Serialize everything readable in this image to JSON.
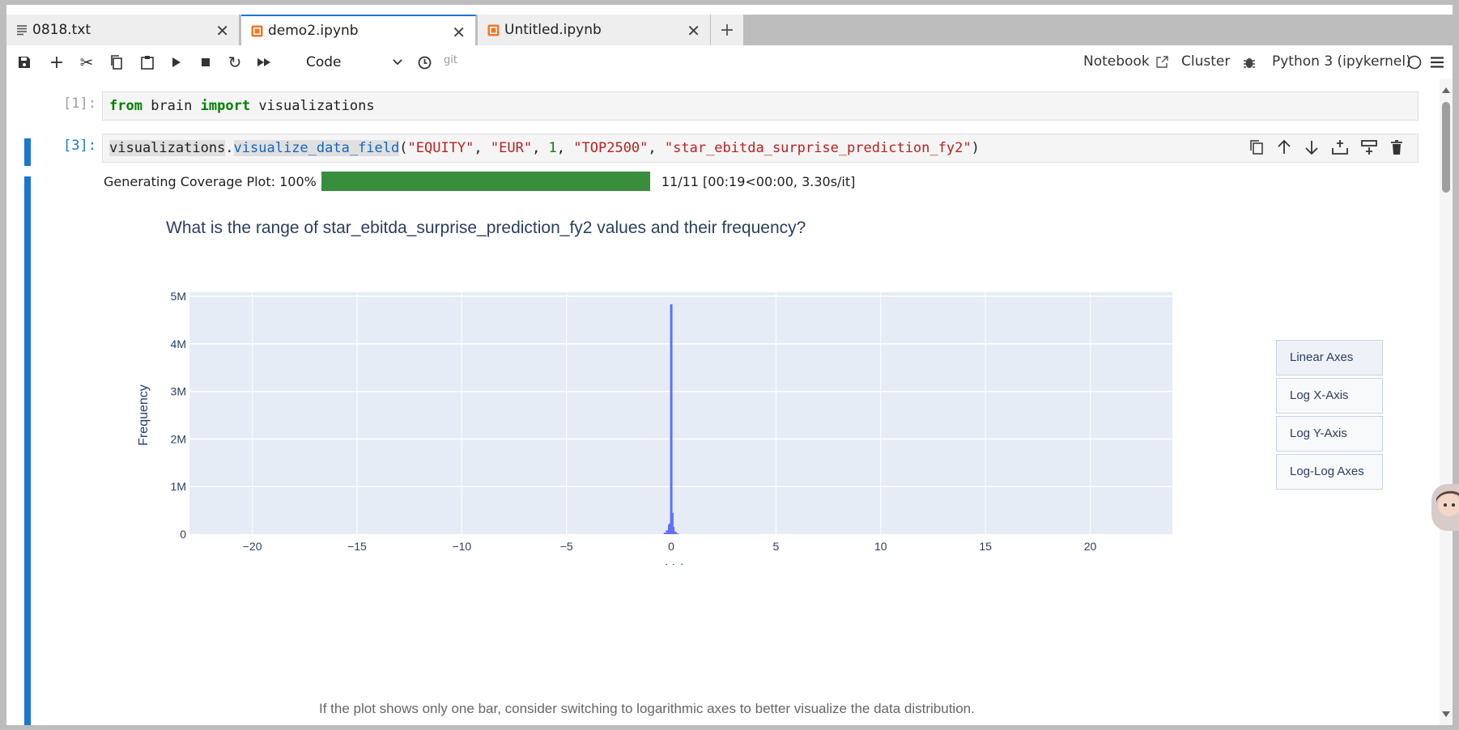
{
  "tabs": [
    {
      "label": "0818.txt",
      "icon": "text-file-icon",
      "active": false
    },
    {
      "label": "demo2.ipynb",
      "icon": "notebook-icon",
      "active": true
    },
    {
      "label": "Untitled.ipynb",
      "icon": "notebook-icon",
      "active": false
    }
  ],
  "toolbar": {
    "cell_type": "Code",
    "git_label": "git",
    "notebook_label": "Notebook",
    "cluster_label": "Cluster",
    "kernel_label": "Python 3 (ipykernel)"
  },
  "cells": [
    {
      "prompt": "[1]:",
      "code": {
        "kw1": "from",
        "mod": "brain",
        "kw2": "import",
        "name": "visualizations"
      }
    },
    {
      "prompt": "[3]:",
      "code": {
        "obj": "visualizations",
        "dot": ".",
        "fn": "visualize_data_field",
        "open": "(",
        "a1": "\"EQUITY\"",
        "c1": ", ",
        "a2": "\"EUR\"",
        "c2": ", ",
        "a3": "1",
        "c3": ", ",
        "a4": "\"TOP2500\"",
        "c4": ", ",
        "a5": "\"star_ebitda_surprise_prediction_fy2\"",
        "close": ")"
      }
    }
  ],
  "progress": {
    "label": "Generating  Coverage  Plot:  100%",
    "percent": 100,
    "stats": "11/11  [00:19<00:00,    3.30s/it]"
  },
  "plot": {
    "title": "What is the range of star_ebitda_surprise_prediction_fy2 values and their frequency?",
    "buttons": [
      "Linear Axes",
      "Log X-Axis",
      "Log Y-Axis",
      "Log-Log Axes"
    ],
    "active_button": "Linear Axes",
    "hint": "If the plot shows only one bar, consider switching to logarithmic axes to better visualize the data distribution."
  },
  "chart_data": {
    "type": "bar",
    "title": "What is the range of star_ebitda_surprise_prediction_fy2 values and their frequency?",
    "xlabel": "Value",
    "ylabel": "Frequency",
    "xlim": [
      -23,
      24
    ],
    "ylim": [
      0,
      5000000
    ],
    "x_ticks": [
      "−20",
      "−15",
      "−10",
      "−5",
      "0",
      "5",
      "10",
      "15",
      "20"
    ],
    "x_tick_values": [
      -20,
      -15,
      -10,
      -5,
      0,
      5,
      10,
      15,
      20
    ],
    "y_ticks": [
      "0",
      "1M",
      "2M",
      "3M",
      "4M",
      "5M"
    ],
    "y_tick_values": [
      0,
      1000000,
      2000000,
      3000000,
      4000000,
      5000000
    ],
    "bar_color": "#636efa",
    "plot_bgcolor": "#e5ecf6",
    "grid": true,
    "bars": [
      {
        "x": -0.3,
        "y": 30000
      },
      {
        "x": -0.2,
        "y": 80000
      },
      {
        "x": -0.1,
        "y": 200000
      },
      {
        "x": -0.05,
        "y": 230000
      },
      {
        "x": 0,
        "y": 4830000
      },
      {
        "x": 0.05,
        "y": 450000
      },
      {
        "x": 0.1,
        "y": 150000
      },
      {
        "x": 0.2,
        "y": 50000
      },
      {
        "x": 0.3,
        "y": 15000
      }
    ]
  }
}
